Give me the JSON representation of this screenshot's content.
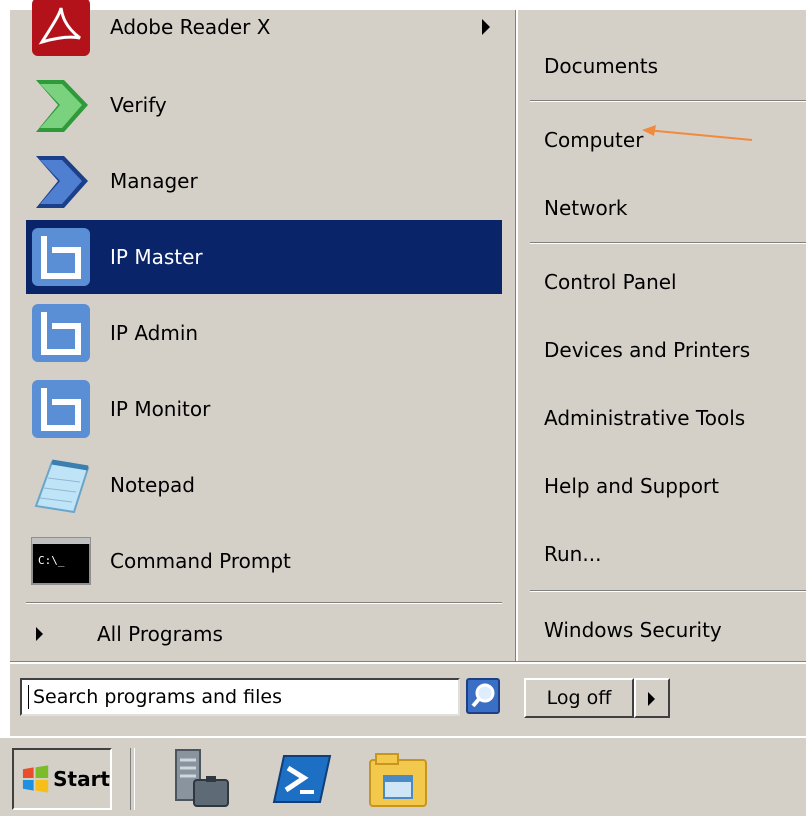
{
  "programs": [
    {
      "label": "Adobe Reader X",
      "icon": "adobe-reader-icon",
      "has_submenu": true
    },
    {
      "label": "Verify",
      "icon": "verify-icon"
    },
    {
      "label": "Manager",
      "icon": "manager-icon"
    },
    {
      "label": "IP Master",
      "icon": "ip-master-icon",
      "selected": true
    },
    {
      "label": "IP Admin",
      "icon": "ip-admin-icon"
    },
    {
      "label": "IP Monitor",
      "icon": "ip-monitor-icon"
    },
    {
      "label": "Notepad",
      "icon": "notepad-icon"
    },
    {
      "label": "Command Prompt",
      "icon": "command-prompt-icon",
      "icon_text": "C:\\_"
    }
  ],
  "all_programs": "All Programs",
  "right_links": [
    {
      "label": "Documents"
    },
    {
      "label": "Computer"
    },
    {
      "label": "Network"
    },
    {
      "label": "Control Panel"
    },
    {
      "label": "Devices and Printers"
    },
    {
      "label": "Administrative Tools",
      "has_submenu": true
    },
    {
      "label": "Help and Support"
    },
    {
      "label": "Run..."
    },
    {
      "label": "Windows Security"
    }
  ],
  "search": {
    "placeholder": "Search programs and files"
  },
  "logoff": {
    "label": "Log off"
  },
  "start": {
    "label": "Start"
  },
  "colors": {
    "selection": "#0a246a",
    "menu_bg": "#d4d0c8",
    "annotation": "#f08a3c"
  }
}
